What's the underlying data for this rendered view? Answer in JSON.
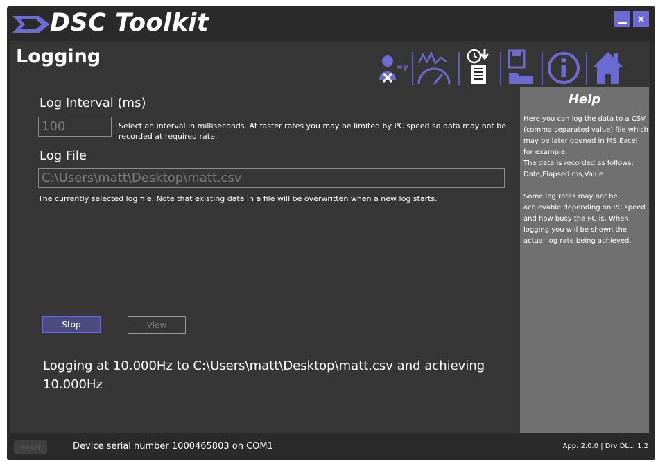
{
  "app": {
    "title": "DSC Toolkit",
    "close_label": "✕"
  },
  "page": {
    "title": "Logging"
  },
  "toolbar": {
    "icons": [
      "calibration-icon",
      "gauge-icon",
      "logging-icon",
      "save-open-icon",
      "info-icon",
      "home-icon"
    ]
  },
  "log_interval": {
    "label": "Log Interval (ms)",
    "value": "100",
    "description": "Select an interval in milliseconds. At faster rates you may be limited by PC speed so data may not be recorded at required rate."
  },
  "log_file": {
    "label": "Log File",
    "value": "C:\\Users\\matt\\Desktop\\matt.csv",
    "description": "The currently selected log file. Note that existing data in a file will be overwritten when a new log starts."
  },
  "buttons": {
    "stop": "Stop",
    "view": "View"
  },
  "status_message": "Logging at 10.000Hz to C:\\Users\\matt\\Desktop\\matt.csv and achieving 10.000Hz",
  "help": {
    "title": "Help",
    "text": "Here you can log the data to a CSV (comma separated value) file which may be later opened in MS Excel for example.\n The data is recorded as follows: Date,Elapsed ms,Value\n\nSome log rates may not be achievable depending on PC speed and how busy the PC is. When logging you will be shown the actual log rate being achieved."
  },
  "statusbar": {
    "reset": "Reset",
    "device": "Device serial number 1000465803 on COM1",
    "version": "App: 2.0.0 | Drv DLL: 1.2"
  },
  "colors": {
    "accent": "#6b6bd1",
    "background": "#2a2a2a",
    "panel": "#363636",
    "help_panel": "#707070"
  }
}
